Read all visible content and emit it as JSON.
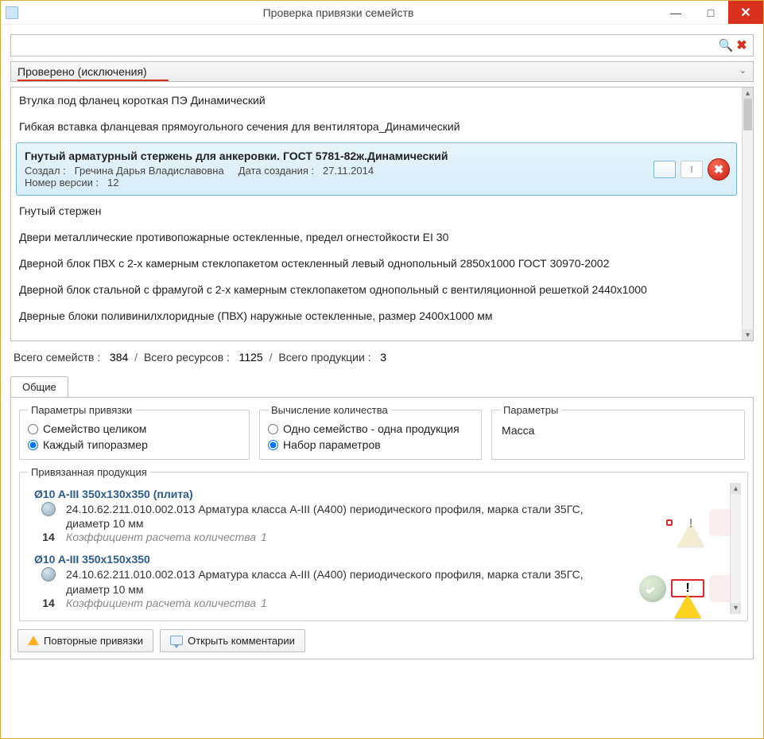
{
  "window": {
    "title": "Проверка привязки семейств"
  },
  "search": {
    "value": ""
  },
  "group_header": "Проверено (исключения)",
  "list": {
    "items": [
      "Втулка под фланец короткая ПЭ Динамический",
      "Гибкая вставка фланцевая прямоугольного сечения для вентилятора_Динамический",
      "Гнутый стержен",
      "Двери металлические противопожарные остекленные, предел огнестойкости EI 30",
      "Дверной блок ПВХ с 2-х камерным стеклопакетом остекленный левый однопольный 2850х1000 ГОСТ 30970-2002",
      "Дверной блок стальной с фрамугой с 2-х камерным стеклопакетом однопольный с вентиляционной решеткой 2440х1000",
      "Дверные блоки поливинилхлоридные (ПВХ) наружные остекленные, размер 2400х1000 мм"
    ],
    "selected": {
      "title": "Гнутый арматурный стержень для анкеровки. ГОСТ 5781-82ж.Динамический",
      "created_by_label": "Создал :",
      "created_by": "Гречина Дарья Владиславовна",
      "created_label": "Дата создания :",
      "created": "27.11.2014",
      "version_label": "Номер версии :",
      "version": "12"
    }
  },
  "stats": {
    "families_label": "Всего семейств :",
    "families": "384",
    "resources_label": "Всего ресурсов :",
    "resources": "1125",
    "products_label": "Всего продукции :",
    "products": "3"
  },
  "tab": {
    "general": "Общие"
  },
  "fieldsets": {
    "binding": {
      "legend": "Параметры привязки",
      "opt1": "Семейство целиком",
      "opt2": "Каждый типоразмер",
      "selected": "opt2"
    },
    "qty": {
      "legend": "Вычисление количества",
      "opt1": "Одно семейство - одна продукция",
      "opt2": "Набор параметров",
      "selected": "opt2"
    },
    "params": {
      "legend": "Параметры",
      "text": "Масса"
    },
    "bound": {
      "legend": "Привязанная продукция"
    }
  },
  "products": [
    {
      "title": "Ø10 A-III 350x130x350 (плита)",
      "desc": "24.10.62.211.010.002.013 Арматура класса A-III (A400) периодического профиля, марка стали 35ГС, диаметр 10 мм",
      "count": "14",
      "coef_label": "Коэффициент расчета количества",
      "coef": "1",
      "status_highlight": "ok"
    },
    {
      "title": "Ø10 A-III 350x150x350",
      "desc": "24.10.62.211.010.002.013 Арматура класса A-III (A400) периодического профиля, марка стали 35ГС, диаметр 10 мм",
      "count": "14",
      "coef_label": "Коэффициент расчета количества",
      "coef": "1",
      "status_highlight": "warn"
    }
  ],
  "buttons": {
    "repeat": "Повторные привязки",
    "comments": "Открыть комментарии"
  }
}
